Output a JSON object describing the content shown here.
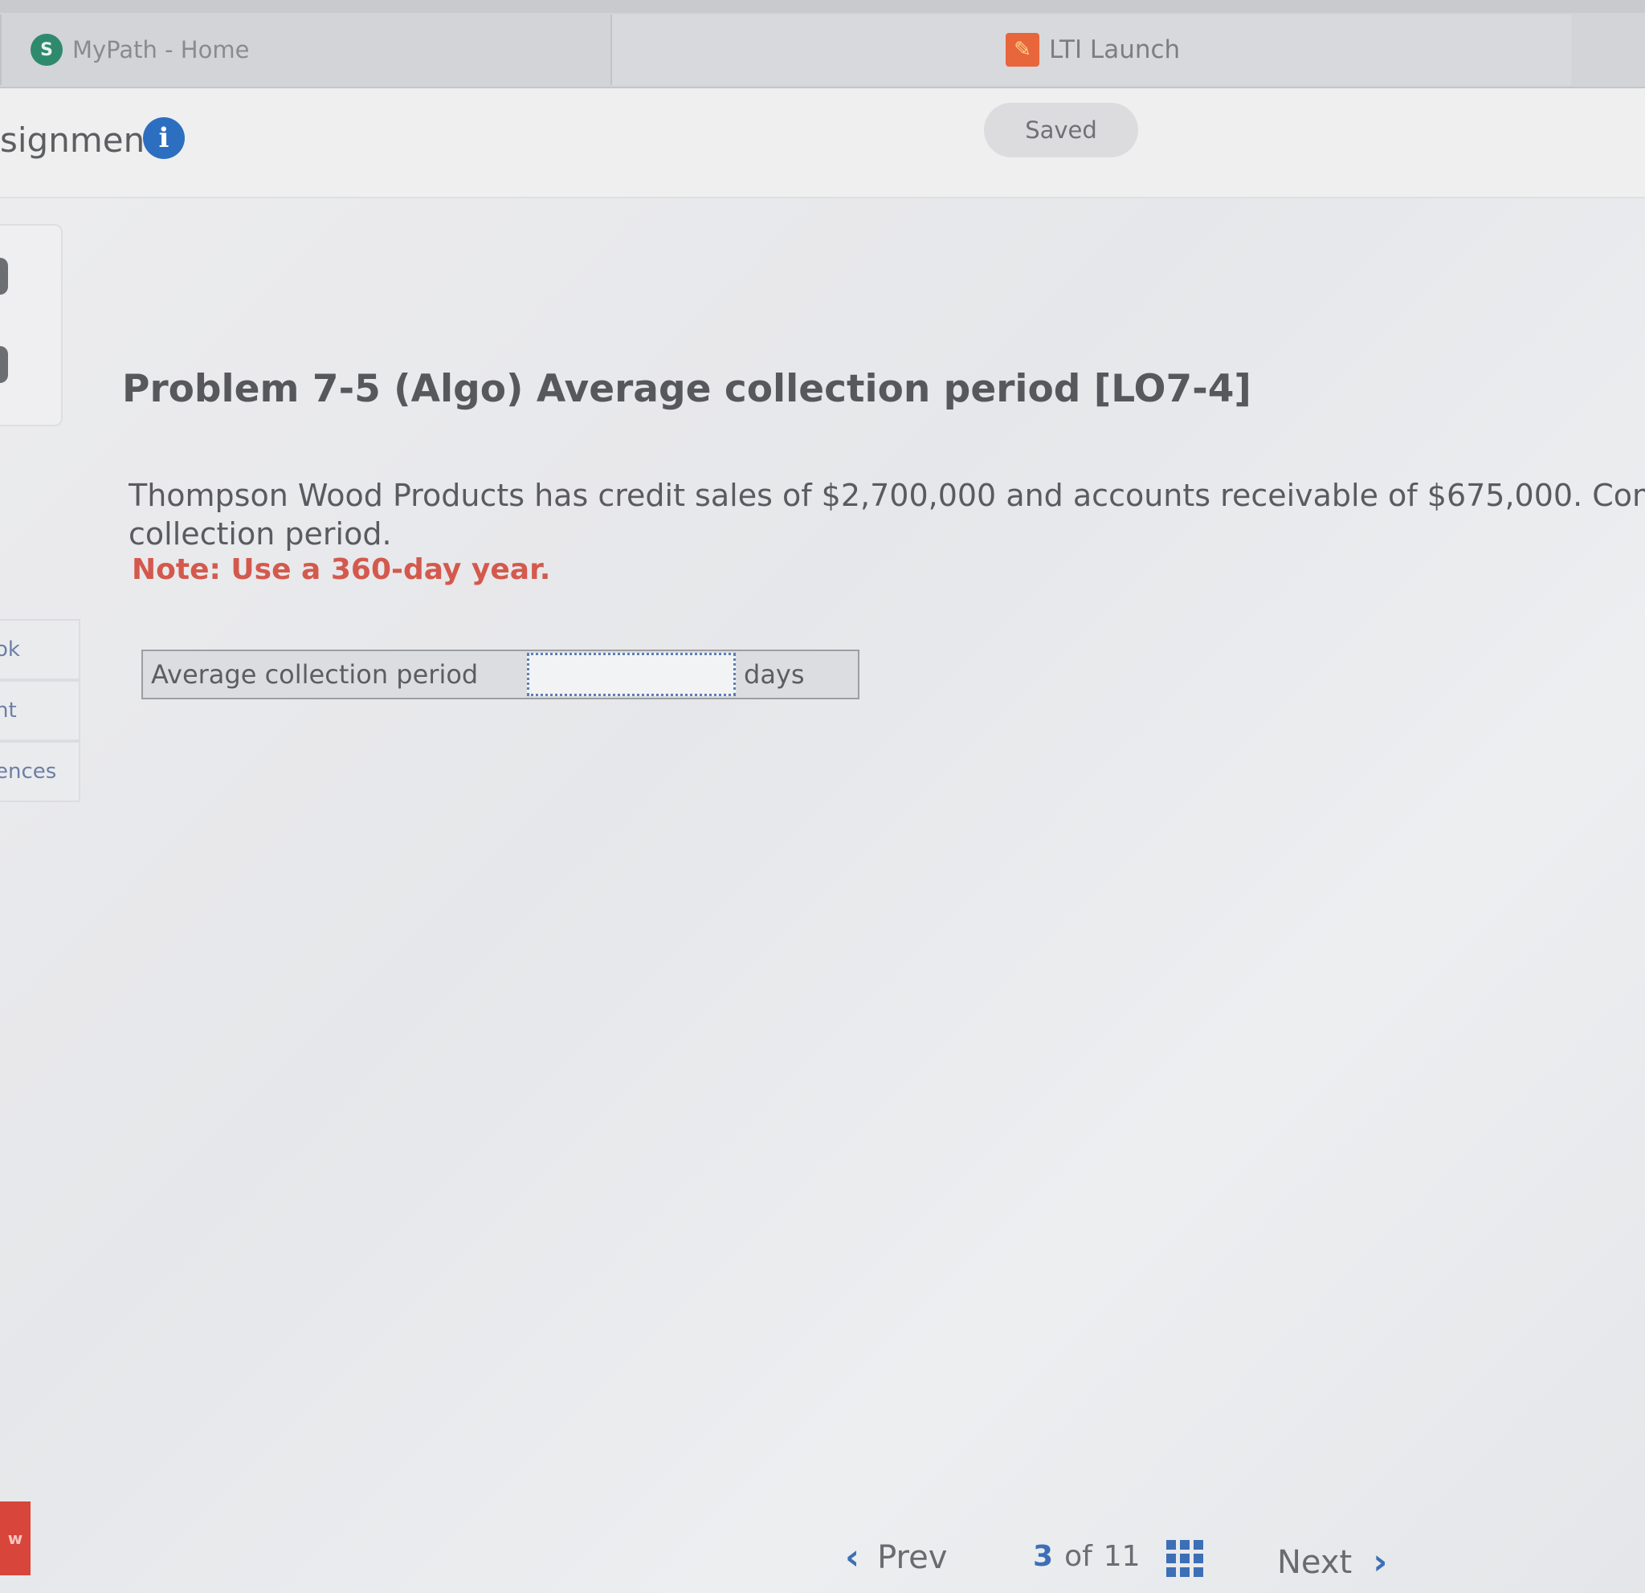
{
  "browser_tabs": [
    {
      "label": "MyPath - Home",
      "favicon": "S"
    },
    {
      "label": "LTI Launch"
    }
  ],
  "header": {
    "title": "signment",
    "save_status": "Saved"
  },
  "sidebar": {
    "items": [
      {
        "label": "ok"
      },
      {
        "label": "nt"
      },
      {
        "label": "ences"
      }
    ]
  },
  "problem": {
    "title": "Problem 7-5 (Algo) Average collection period [LO7-4]",
    "text_line1": "Thompson Wood Products has credit sales of $2,700,000 and accounts receivable of $675,000. Com",
    "text_line2": "collection period.",
    "note": "Note: Use a 360-day year."
  },
  "answer": {
    "label": "Average collection period",
    "value": "",
    "unit": "days"
  },
  "brand_tab": "w",
  "navigation": {
    "prev_label": "Prev",
    "current_page": "3",
    "of_label": "of",
    "total_pages": "11",
    "next_label": "Next"
  },
  "colors": {
    "accent": "#3c6fb6",
    "note_red": "#d4594d",
    "brand_red": "#d8453b"
  }
}
